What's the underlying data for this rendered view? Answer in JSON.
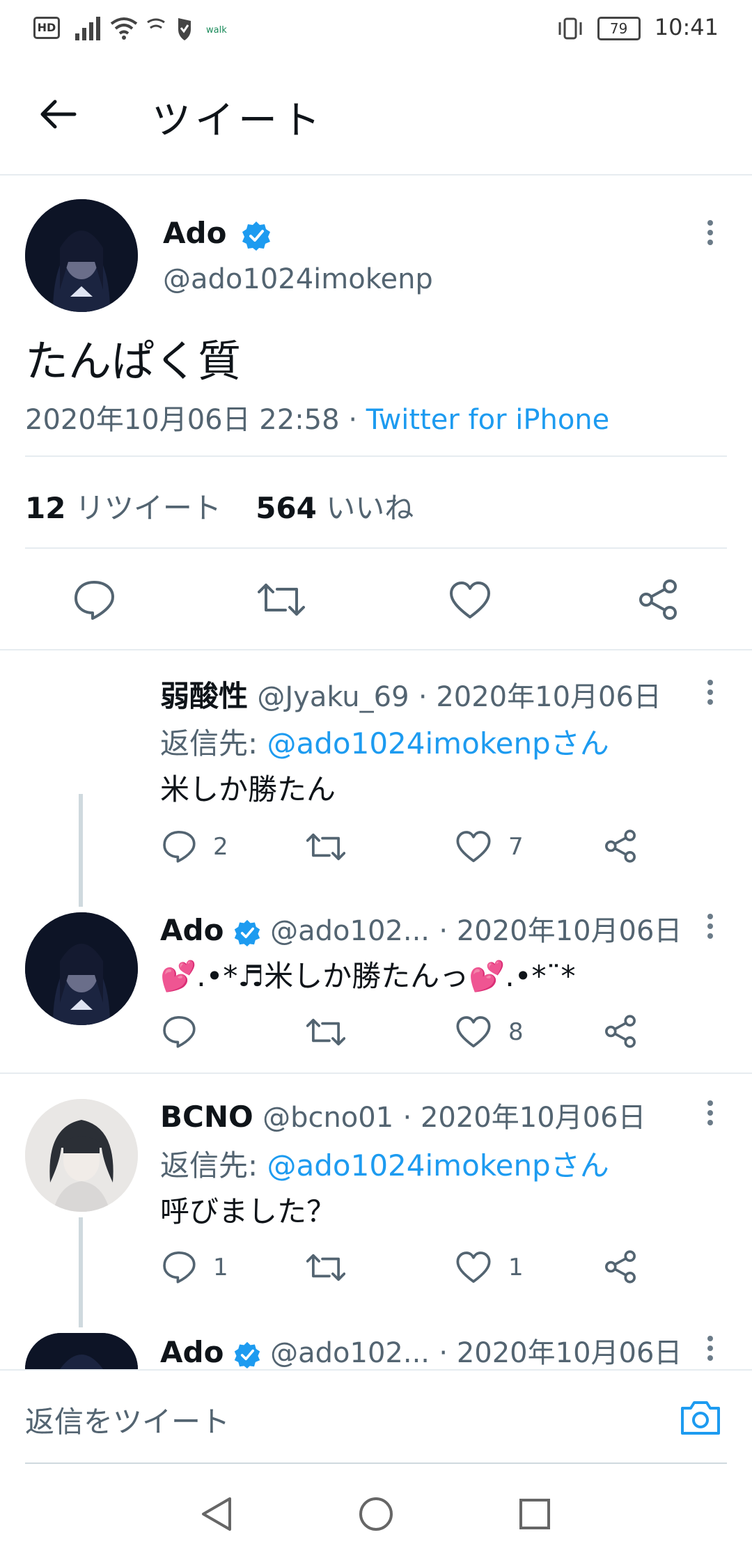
{
  "status_bar": {
    "left_icons": [
      "hd-icon",
      "signal-icon",
      "wifi-icon",
      "nfc-icon",
      "shield-icon",
      "walk-icon"
    ],
    "walk_label": "walk",
    "battery": "79",
    "time": "10:41"
  },
  "header": {
    "title": "ツイート"
  },
  "main_tweet": {
    "name": "Ado",
    "handle": "@ado1024imokenp",
    "text": "たんぱく質",
    "datetime": "2020年10月06日 22:58",
    "dot": "·",
    "source": "Twitter for iPhone",
    "retweets_count": "12",
    "retweets_label": "リツイート",
    "likes_count": "564",
    "likes_label": "いいね"
  },
  "replies": [
    {
      "name": "弱酸性",
      "handle": "@Jyaku_69",
      "date": "· 2020年10月06日",
      "reply_prefix": "返信先:",
      "reply_to": "@ado1024imokenpさん",
      "text": "米しか勝たん",
      "reply_count": "2",
      "retweet_count": "",
      "like_count": "7"
    },
    {
      "name": "Ado",
      "handle": "@ado102...",
      "date": "· 2020年10月06日",
      "text": "💕.•*♬米しか勝たんっ💕.•*¨*",
      "reply_count": "",
      "retweet_count": "",
      "like_count": "8"
    },
    {
      "name": "BCNO",
      "handle": "@bcno01",
      "date": "· 2020年10月06日",
      "reply_prefix": "返信先:",
      "reply_to": "@ado1024imokenpさん",
      "text": "呼びました？",
      "reply_count": "1",
      "retweet_count": "",
      "like_count": "1"
    },
    {
      "name": "Ado",
      "handle": "@ado102...",
      "date": "· 2020年10月06日"
    }
  ],
  "composer": {
    "placeholder": "返信をツイート"
  },
  "colors": {
    "accent": "#1d9bf0",
    "text": "#0f1419",
    "muted": "#536471",
    "divider": "#e6ecf0"
  }
}
